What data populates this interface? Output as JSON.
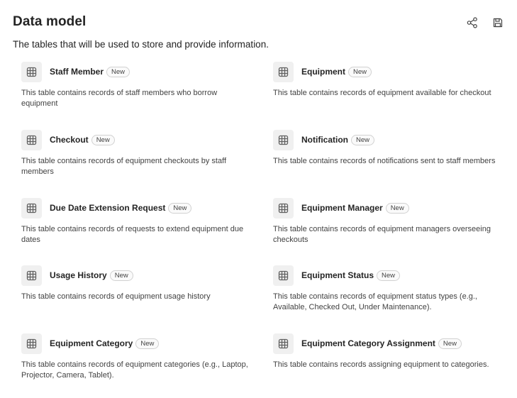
{
  "header": {
    "title": "Data model",
    "subtitle": "The tables that will be used to store and provide information."
  },
  "toolbar": {
    "icons": [
      "share-diagram-icon",
      "save-icon"
    ]
  },
  "badge_label": "New",
  "tables": [
    {
      "name": "Staff Member",
      "description": "This table contains records of staff members who borrow equipment"
    },
    {
      "name": "Equipment",
      "description": "This table contains records of equipment available for checkout"
    },
    {
      "name": "Checkout",
      "description": "This table contains records of equipment checkouts by staff members"
    },
    {
      "name": "Notification",
      "description": "This table contains records of notifications sent to staff members"
    },
    {
      "name": "Due Date Extension Request",
      "description": "This table contains records of requests to extend equipment due dates"
    },
    {
      "name": "Equipment Manager",
      "description": "This table contains records of equipment managers overseeing checkouts"
    },
    {
      "name": "Usage History",
      "description": "This table contains records of equipment usage history"
    },
    {
      "name": "Equipment Status",
      "description": "This table contains records of equipment status types (e.g., Available, Checked Out, Under Maintenance)."
    },
    {
      "name": "Equipment Category",
      "description": "This table contains records of equipment categories (e.g., Laptop, Projector, Camera, Tablet)."
    },
    {
      "name": "Equipment Category Assignment",
      "description": "This table contains records assigning equipment to categories."
    }
  ]
}
